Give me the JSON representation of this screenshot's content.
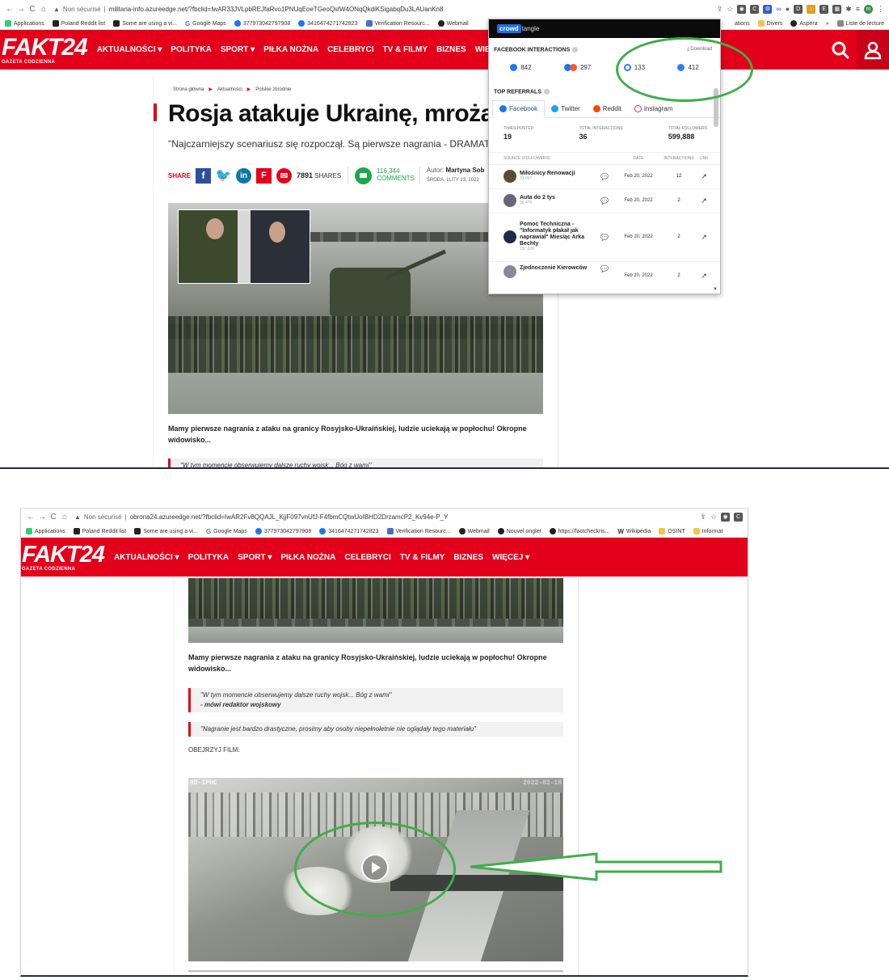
{
  "screenshot1": {
    "browser": {
      "security": "Non sécurisé",
      "url": "militaria-info.azureedge.net/?fbclid=IwAR33JVLpbREJfaRvo1PNUqEoeTGeoQslW4ONqQkdiKSigabqDu3LAUanKn8"
    },
    "bookmarks": [
      "Applications",
      "Poland Reddit list",
      "Some are using a vi...",
      "Google Maps",
      "377973042797908",
      "3416474271742823",
      "Verification Resourc...",
      "Webmail"
    ],
    "bookmarks_right": [
      "ations",
      "Divers",
      "Aspera",
      "»",
      "Liste de lecture"
    ],
    "site": {
      "logo": "FAKT24",
      "logo_sub": "GAZETA CODZIENNA",
      "menu": [
        "AKTUALNOŚCI ▾",
        "POLITYKA",
        "SPORT ▾",
        "PIŁKA NOŻNA",
        "CELEBRYCI",
        "TV & FILMY",
        "BIZNES",
        "WIĘCEJ ▾"
      ]
    },
    "article": {
      "breadcrumb": [
        "Strona główna",
        "Aktualności",
        "Polskie zbrodnie"
      ],
      "title": "Rosja atakuje Ukrainę, mrożące kre",
      "lead": "\"Najczarniejszy scenariusz się rozpoczął. Są pierwsze nagrania - DRAMAT\"",
      "share_label": "SHARE",
      "shares_count": "7891",
      "shares_word": "SHARES",
      "comments_count": "116,344",
      "comments_word": "COMMENTS",
      "author_label": "Autor:",
      "author_name": "Martyna Sob",
      "date": "ŚRODA, LUTY 23, 2022",
      "caption": "Mamy pierwsze nagrania z ataku na granicy Rosyjsko-Ukraińskiej, ludzie uciekają w popłochu! Okropne widowisko...",
      "quote_partial": "\"W tym momencie obserwujemy dalsze ruchy wojsk... Bóg z wami\""
    },
    "crowdtangle": {
      "logo": "crowd",
      "logo_rest": "tangle",
      "interactions_title": "FACEBOOK INTERACTIONS",
      "download": "Download",
      "metrics": [
        "842",
        "297",
        "133",
        "412"
      ],
      "referrals_title": "TOP REFERRALS",
      "tabs": [
        "Facebook",
        "Twitter",
        "Reddit",
        "Instagram"
      ],
      "stats": [
        {
          "label": "TIMES POSTED",
          "value": "19"
        },
        {
          "label": "TOTAL INTERACTIONS",
          "value": "36"
        },
        {
          "label": "TOTAL FOLLOWERS",
          "value": "599,888"
        }
      ],
      "columns": [
        "SOURCE (FOLLOWERS)",
        "DATE",
        "INTERACTIONS",
        "LINK"
      ],
      "rows": [
        {
          "source": "Miłośnicy Renowacji",
          "followers": "33,007",
          "date": "Feb 20, 2022",
          "interactions": "12"
        },
        {
          "source": "Auta do 2 tys",
          "followers": "56,470",
          "date": "Feb 20, 2022",
          "interactions": "2"
        },
        {
          "source": "Pomoc Techniczna - \"Informatyk płakał jak naprawiał\" Miesiąc Arka Bechty",
          "followers": "157,636",
          "date": "Feb 20, 2022",
          "interactions": "2"
        },
        {
          "source": "Zjednoczenie Kierowców",
          "followers": "",
          "date": "Feb 20, 2022",
          "interactions": "2"
        }
      ]
    }
  },
  "screenshot2": {
    "browser": {
      "security": "Non sécurisé",
      "url": "obrona24.azureedge.net/?fbclid=IwAR2Fv8QQAJL_KjjF097vnUfJ-F4fbmCQtwUoIBHD2DrzamcP2_Kv94e-P_Y"
    },
    "bookmarks": [
      "Applications",
      "Poland Reddit list",
      "Some are using a vi...",
      "Google Maps",
      "377973042797908",
      "3416474271742823",
      "Verification Resourc...",
      "Webmail",
      "Nouvel onglet",
      "https://factcheckris...",
      "Wikipédia",
      "OSINT",
      "Informat"
    ],
    "site": {
      "logo": "FAKT24",
      "logo_sub": "GAZETA CODZIENNA",
      "menu": [
        "AKTUALNOŚCI ▾",
        "POLITYKA",
        "SPORT ▾",
        "PIŁKA NOŻNA",
        "CELEBRYCI",
        "TV & FILMY",
        "BIZNES",
        "WIĘCEJ ▾"
      ]
    },
    "article": {
      "caption": "Mamy pierwsze nagrania z ataku na granicy Rosyjsko-Ukraińskiej, ludzie uciekają w popłochu! Okropne widowisko...",
      "quote1": "\"W tym momencie obserwujemy dalsze ruchy wojsk... Bóg z wami\"",
      "quote1_by": "- mówi redaktor wojskowy",
      "quote2": "\"Nagranie jest bardzo drastyczne, prosimy aby osoby niepełnoletnie nie oglądały tego materiału\"",
      "watch_label": "OBEJRZYJ FILM:",
      "video_tag_left": "HD-IPHC",
      "video_tag_right": "2022-02-19"
    }
  },
  "colors": {
    "brand_red": "#e3001b",
    "highlight_green": "#3fae49",
    "crowdtangle_blue": "#1d6fe8"
  }
}
